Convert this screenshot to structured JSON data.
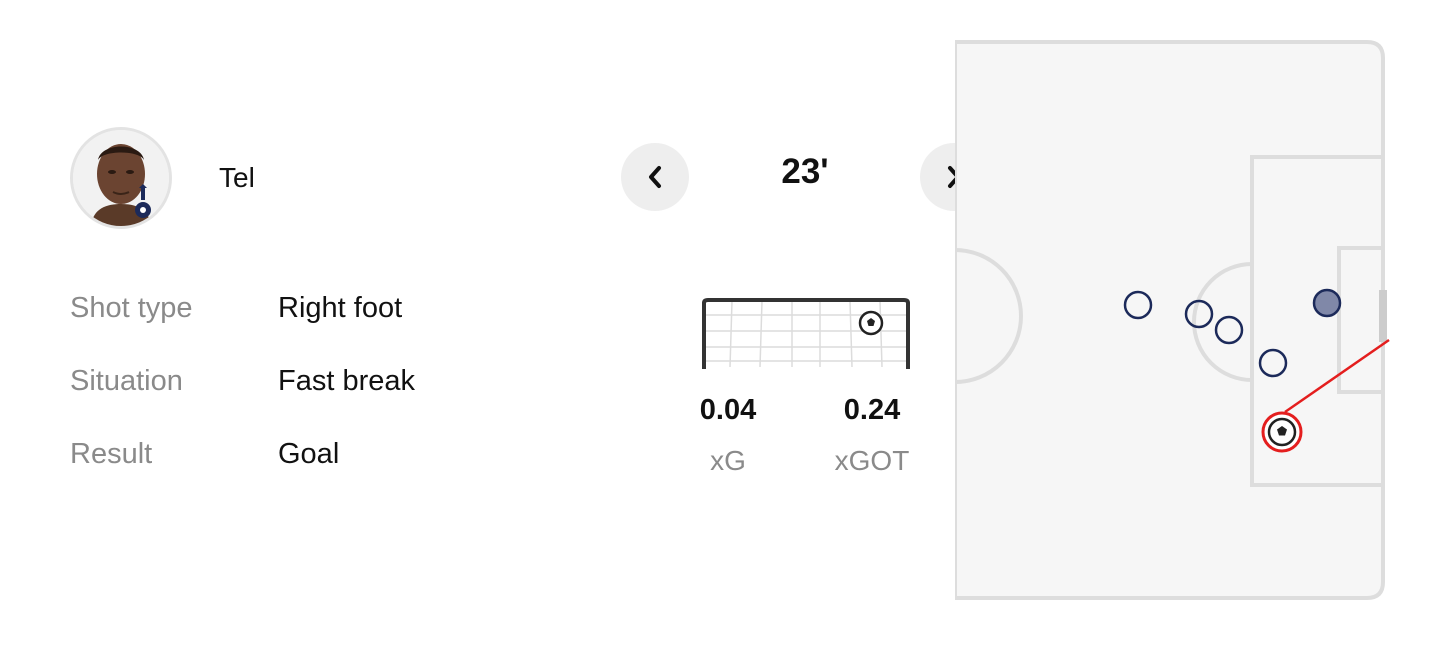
{
  "player": {
    "name": "Tel"
  },
  "shot": {
    "minute": "23'",
    "details": [
      {
        "label": "Shot type",
        "value": "Right foot"
      },
      {
        "label": "Situation",
        "value": "Fast break"
      },
      {
        "label": "Result",
        "value": "Goal"
      }
    ],
    "xg": {
      "value": "0.04",
      "label": "xG"
    },
    "xgot": {
      "value": "0.24",
      "label": "xGOT"
    }
  },
  "colors": {
    "goal_line": "#e41e1e",
    "defender": "#1c2a5a",
    "keeper_fill": "#8088a8",
    "pitch": "#f6f6f6"
  },
  "icons": {
    "prev": "chevron-left-icon",
    "next": "chevron-right-icon"
  }
}
